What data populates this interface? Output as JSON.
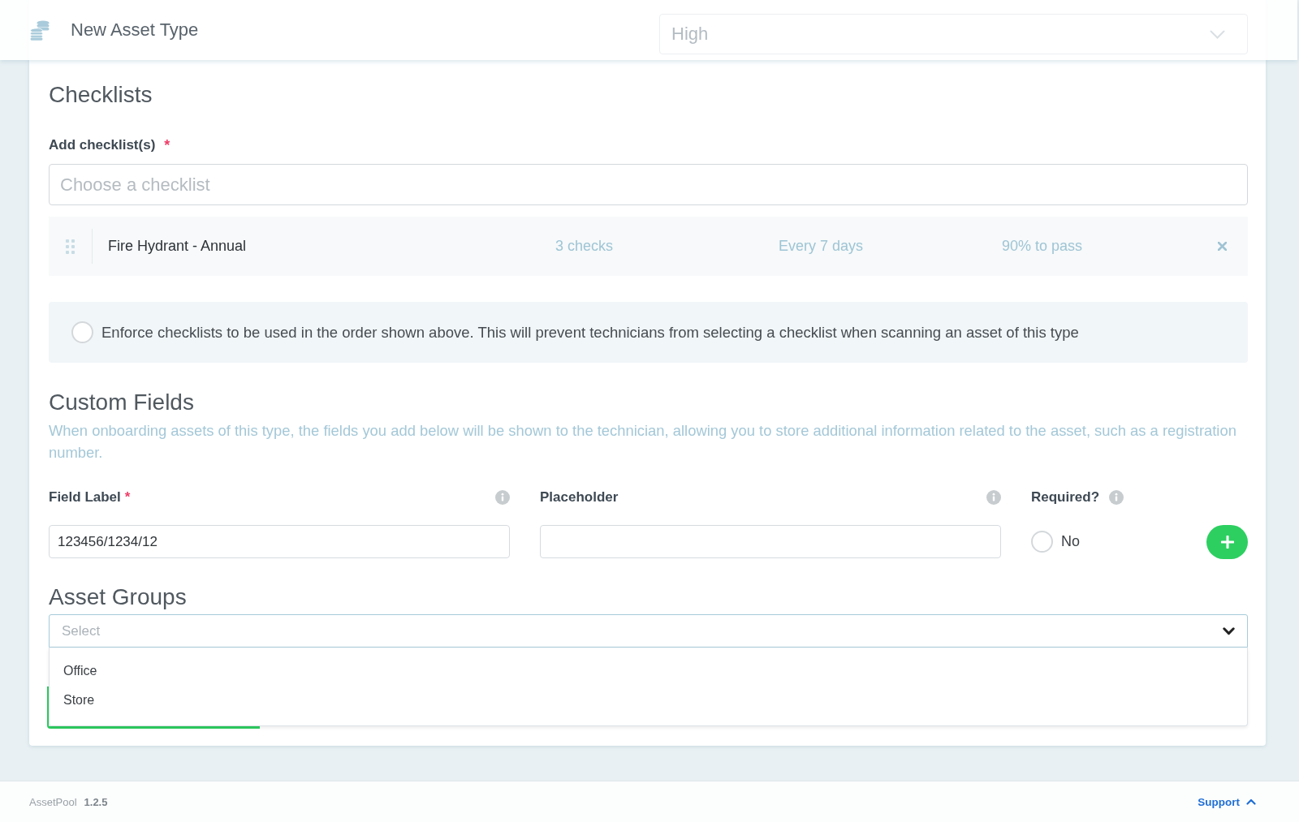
{
  "header": {
    "title": "New Asset Type"
  },
  "top_form_row": {
    "select": {
      "value": "High"
    }
  },
  "checklists": {
    "heading": "Checklists",
    "add_label": "Add checklist(s)",
    "required_mark": "*",
    "picker": {
      "placeholder": "Choose a checklist"
    },
    "items": [
      {
        "name": "Fire Hydrant - Annual",
        "checks": "3 checks",
        "frequency": "Every 7 days",
        "pass_mark": "90% to pass"
      }
    ],
    "enforce_order": {
      "label": "Enforce checklists to be used in the order shown above. This will prevent technicians from selecting a checklist when scanning an asset of this type",
      "checked": false
    }
  },
  "custom_fields": {
    "heading": "Custom Fields",
    "description": "When onboarding assets of this type, the fields you add below will be shown to the technician, allowing you to store additional information related to the asset, such as a registration number.",
    "field_label": {
      "label": "Field Label",
      "required_mark": "*",
      "value": "123456/1234/12"
    },
    "placeholder_field": {
      "label": "Placeholder"
    },
    "required": {
      "label": "Required?",
      "option": "No",
      "checked": false
    }
  },
  "asset_groups": {
    "heading": "Asset Groups",
    "select": {
      "placeholder": "Select",
      "expanded": true,
      "options": [
        {
          "label": "Office",
          "selected": false
        },
        {
          "label": "Store",
          "selected": false
        }
      ]
    }
  },
  "footer": {
    "app_name": "AssetPool",
    "version": "1.2.5",
    "support_link": "Support"
  }
}
